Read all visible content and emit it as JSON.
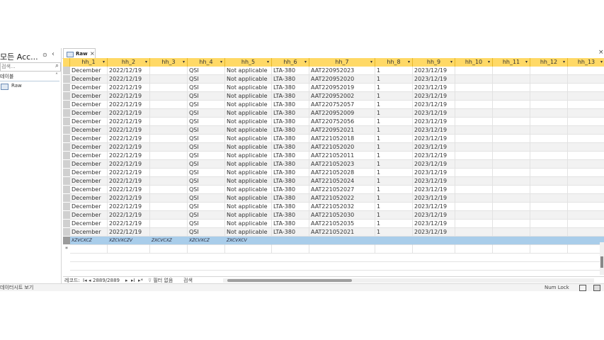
{
  "nav": {
    "title": "모든 Acc...",
    "search_placeholder": "검색...",
    "group_label": "테이블",
    "items": [
      {
        "label": "Raw"
      }
    ]
  },
  "tab": {
    "label": "Raw",
    "close": "×"
  },
  "doc_close": "×",
  "columns": [
    "hh_1",
    "hh_2",
    "hh_3",
    "hh_4",
    "hh_5",
    "hh_6",
    "hh_7",
    "hh_8",
    "hh_9",
    "hh_10",
    "hh_11",
    "hh_12",
    "hh_13"
  ],
  "rows": [
    [
      "December",
      "2022/12/19",
      "",
      "QSI",
      "Not applicable",
      "LTA-380",
      "AAT220952023",
      "1",
      "2023/12/19"
    ],
    [
      "December",
      "2022/12/19",
      "",
      "QSI",
      "Not applicable",
      "LTA-380",
      "AAT220952020",
      "1",
      "2023/12/19"
    ],
    [
      "December",
      "2022/12/19",
      "",
      "QSI",
      "Not applicable",
      "LTA-380",
      "AAT220952019",
      "1",
      "2023/12/19"
    ],
    [
      "December",
      "2022/12/19",
      "",
      "QSI",
      "Not applicable",
      "LTA-380",
      "AAT220952002",
      "1",
      "2023/12/19"
    ],
    [
      "December",
      "2022/12/19",
      "",
      "QSI",
      "Not applicable",
      "LTA-380",
      "AAT220752057",
      "1",
      "2023/12/19"
    ],
    [
      "December",
      "2022/12/19",
      "",
      "QSI",
      "Not applicable",
      "LTA-380",
      "AAT220952009",
      "1",
      "2023/12/19"
    ],
    [
      "December",
      "2022/12/19",
      "",
      "QSI",
      "Not applicable",
      "LTA-380",
      "AAT220752056",
      "1",
      "2023/12/19"
    ],
    [
      "December",
      "2022/12/19",
      "",
      "QSI",
      "Not applicable",
      "LTA-380",
      "AAT220952021",
      "1",
      "2023/12/19"
    ],
    [
      "December",
      "2022/12/19",
      "",
      "QSI",
      "Not applicable",
      "LTA-380",
      "AAT221052018",
      "1",
      "2023/12/19"
    ],
    [
      "December",
      "2022/12/19",
      "",
      "QSI",
      "Not applicable",
      "LTA-380",
      "AAT221052020",
      "1",
      "2023/12/19"
    ],
    [
      "December",
      "2022/12/19",
      "",
      "QSI",
      "Not applicable",
      "LTA-380",
      "AAT221052011",
      "1",
      "2023/12/19"
    ],
    [
      "December",
      "2022/12/19",
      "",
      "QSI",
      "Not applicable",
      "LTA-380",
      "AAT221052023",
      "1",
      "2023/12/19"
    ],
    [
      "December",
      "2022/12/19",
      "",
      "QSI",
      "Not applicable",
      "LTA-380",
      "AAT221052028",
      "1",
      "2023/12/19"
    ],
    [
      "December",
      "2022/12/19",
      "",
      "QSI",
      "Not applicable",
      "LTA-380",
      "AAT221052024",
      "1",
      "2023/12/19"
    ],
    [
      "December",
      "2022/12/19",
      "",
      "QSI",
      "Not applicable",
      "LTA-380",
      "AAT221052027",
      "1",
      "2023/12/19"
    ],
    [
      "December",
      "2022/12/19",
      "",
      "QSI",
      "Not applicable",
      "LTA-380",
      "AAT221052022",
      "1",
      "2023/12/19"
    ],
    [
      "December",
      "2022/12/19",
      "",
      "QSI",
      "Not applicable",
      "LTA-380",
      "AAT221052032",
      "1",
      "2023/12/19"
    ],
    [
      "December",
      "2022/12/19",
      "",
      "QSI",
      "Not applicable",
      "LTA-380",
      "AAT221052030",
      "1",
      "2023/12/19"
    ],
    [
      "December",
      "2022/12/19",
      "",
      "QSI",
      "Not applicable",
      "LTA-380",
      "AAT221052035",
      "1",
      "2023/12/19"
    ],
    [
      "December",
      "2022/12/19",
      "",
      "QSI",
      "Not applicable",
      "LTA-380",
      "AAT221052021",
      "1",
      "2023/12/19"
    ]
  ],
  "selected_row": [
    "XZVCXCZ",
    "XZCVXCZV",
    "ZXCVCXZ",
    "XZCVXCZ",
    "ZXCVXCV"
  ],
  "new_row_marker": "*",
  "record_nav": {
    "label": "레코드:",
    "first": "I◂",
    "prev": "◂",
    "position": "2889/2889",
    "next": "▸",
    "last": "▸I",
    "new": "▸*",
    "filter": "필터 없음",
    "search": "검색"
  },
  "status": {
    "left": "데이터시트 보기",
    "right": "Num Lock"
  },
  "colors": {
    "header": "#ffd966",
    "selected_row": "#a9cdea",
    "alt_row": "#f2f2f2"
  }
}
